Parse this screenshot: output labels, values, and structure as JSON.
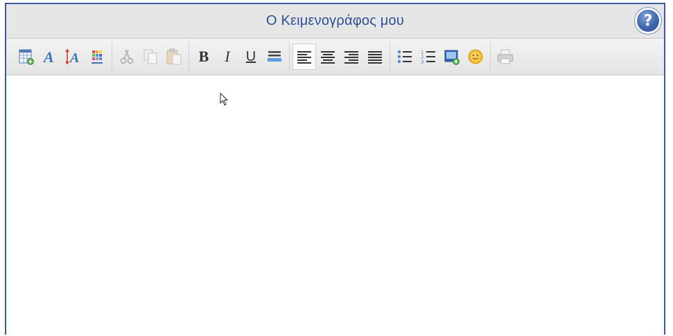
{
  "window": {
    "title": "Ο Κειμενογράφος μου",
    "help_label": "?"
  },
  "toolbar": {
    "bold_label": "B",
    "italic_label": "I",
    "underline_label": "U",
    "active_alignment": "align-left",
    "icons": [
      "insert-table-icon",
      "font-style-icon",
      "font-size-icon",
      "color-palette-icon",
      "cut-icon",
      "copy-icon",
      "paste-icon",
      "bold-icon",
      "italic-icon",
      "underline-icon",
      "highlight-icon",
      "align-left-icon",
      "align-center-icon",
      "align-right-icon",
      "align-justify-icon",
      "bullet-list-icon",
      "numbered-list-icon",
      "insert-image-icon",
      "emoji-icon",
      "print-icon"
    ]
  },
  "editor": {
    "content": ""
  },
  "colors": {
    "accent": "#2e4f98",
    "border": "#3a5a9c",
    "toolbar": "#e6e6e6"
  }
}
